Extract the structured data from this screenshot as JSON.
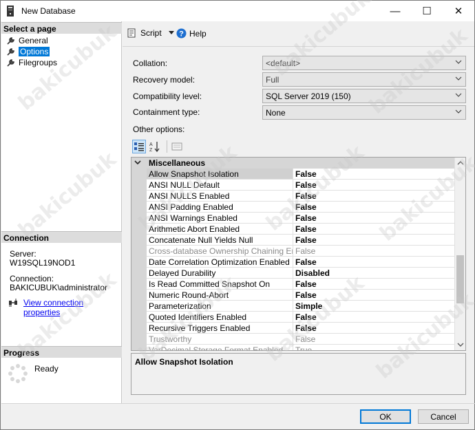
{
  "window": {
    "title": "New Database",
    "min_glyph": "—",
    "max_glyph": "☐",
    "close_glyph": "✕"
  },
  "left": {
    "select_page_header": "Select a page",
    "pages": [
      {
        "label": "General",
        "icon": "wrench-icon"
      },
      {
        "label": "Options",
        "icon": "wrench-icon",
        "selected": true
      },
      {
        "label": "Filegroups",
        "icon": "wrench-icon"
      }
    ],
    "connection_header": "Connection",
    "server_label": "Server:",
    "server_value": "W19SQL19NOD1",
    "connection_label": "Connection:",
    "connection_value": "BAKICUBUK\\administrator",
    "view_connection_link": "View connection properties",
    "progress_header": "Progress",
    "progress_status": "Ready"
  },
  "toolbar": {
    "script_label": "Script",
    "help_label": "Help"
  },
  "form": {
    "collation_label": "Collation:",
    "collation_value": "<default>",
    "recovery_label": "Recovery model:",
    "recovery_value": "Full",
    "compat_label": "Compatibility level:",
    "compat_value": "SQL Server 2019 (150)",
    "containment_label": "Containment type:",
    "containment_value": "None",
    "other_options_label": "Other options:"
  },
  "grid": {
    "category": "Miscellaneous",
    "rows": [
      {
        "name": "Allow Snapshot Isolation",
        "value": "False",
        "selected": true
      },
      {
        "name": "ANSI NULL Default",
        "value": "False"
      },
      {
        "name": "ANSI NULLS Enabled",
        "value": "False"
      },
      {
        "name": "ANSI Padding Enabled",
        "value": "False"
      },
      {
        "name": "ANSI Warnings Enabled",
        "value": "False"
      },
      {
        "name": "Arithmetic Abort Enabled",
        "value": "False"
      },
      {
        "name": "Concatenate Null Yields Null",
        "value": "False"
      },
      {
        "name": "Cross-database Ownership Chaining Enabled",
        "value": "False",
        "disabled": true
      },
      {
        "name": "Date Correlation Optimization Enabled",
        "value": "False"
      },
      {
        "name": "Delayed Durability",
        "value": "Disabled"
      },
      {
        "name": "Is Read Committed Snapshot On",
        "value": "False"
      },
      {
        "name": "Numeric Round-Abort",
        "value": "False"
      },
      {
        "name": "Parameterization",
        "value": "Simple"
      },
      {
        "name": "Quoted Identifiers Enabled",
        "value": "False"
      },
      {
        "name": "Recursive Triggers Enabled",
        "value": "False"
      },
      {
        "name": "Trustworthy",
        "value": "False",
        "disabled": true
      },
      {
        "name": "VarDecimal Storage Format Enabled",
        "value": "True",
        "disabled": true
      }
    ],
    "description_title": "Allow Snapshot Isolation"
  },
  "buttons": {
    "ok": "OK",
    "cancel": "Cancel"
  },
  "watermark": "bakicubuk",
  "colors": {
    "accent": "#0078d7",
    "link": "#0000ee"
  }
}
